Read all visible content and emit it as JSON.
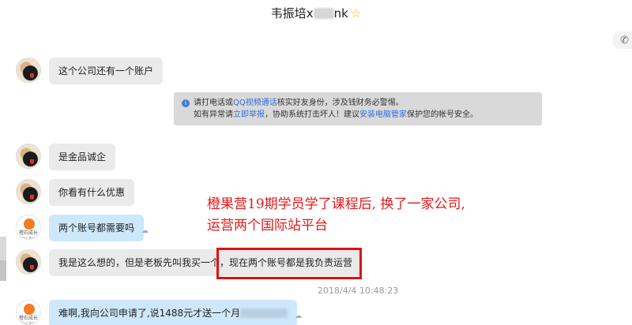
{
  "window": {
    "title_visible": "韦振培x",
    "title_suffix": "nk",
    "star": "☆"
  },
  "notice": {
    "line1_prefix": "请打电话或",
    "line1_link": "QQ视频通话",
    "line1_suffix": "核实好友身份，涉及钱财务必警惕。",
    "line2_prefix": "如有异常请",
    "line2_link1": "立即举报",
    "line2_middle": "，协助系统打击坏人！建议",
    "line2_link2": "安装电脑管家",
    "line2_suffix": "保护您的帐号安全。"
  },
  "messages": [
    {
      "sender": "contact",
      "text": "这个公司还有一个账户"
    },
    {
      "sender": "contact",
      "text": "是金品诚企"
    },
    {
      "sender": "contact",
      "text": "你看有什么优惠"
    },
    {
      "sender": "self",
      "text": "两个账号都需要吗"
    },
    {
      "sender": "contact",
      "text_part1": "我是这么想的，但是老板先叫我买一个，",
      "text_part2": "现在两个账号都是我负责运营"
    },
    {
      "sender": "self",
      "text": "难啊,我向公司申请了,说1488元才送一个月"
    }
  ],
  "timestamp": "2018/4/4 10:48:23",
  "annotation": {
    "line1": "橙果营19期学员学了课程后, 换了一家公司,",
    "line2": "运营两个国际站平台"
  },
  "logo_avatar": {
    "name": "橙石成长",
    "tagline": "Your Best"
  },
  "colors": {
    "incoming_bubble": "#eaeaea",
    "outgoing_bubble": "#cde8fb",
    "annotation_red": "#e31a1a",
    "link_blue": "#2f6fdb"
  }
}
